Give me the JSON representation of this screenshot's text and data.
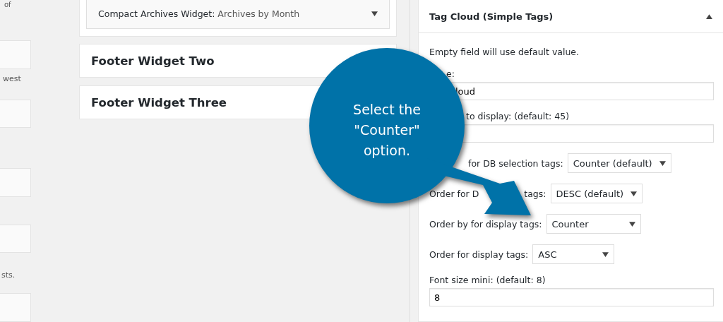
{
  "left_column": {
    "texts": [
      "of",
      "west",
      "sts."
    ]
  },
  "widget_area": {
    "widget": {
      "title": "**Compact Archives Widget:** Archives by Month",
      "expanded": false
    },
    "sidebars": [
      {
        "title": "Footer Widget Two"
      },
      {
        "title": "Footer Widget Three"
      }
    ]
  },
  "tag_cloud_widget": {
    "title": "Tag Cloud (Simple Tags)",
    "expanded": true,
    "note": "Empty field will use default value.",
    "rows": [
      {
        "kind": "field",
        "label": [
          "e:"
        ],
        "value": "loud"
      },
      {
        "kind": "field",
        "label": [
          "to display: (default: 45)"
        ],
        "value": ""
      },
      {
        "kind": "select",
        "label": [
          "for DB selection tags:"
        ],
        "value": "Counter (default)"
      },
      {
        "kind": "select",
        "label": [
          "Order for D",
          "tags:"
        ],
        "value": "DESC (default)"
      },
      {
        "kind": "select",
        "label": [
          "Order by for display tags:"
        ],
        "value": "Counter"
      },
      {
        "kind": "select",
        "label": [
          "Order for display tags:"
        ],
        "value": "ASC"
      },
      {
        "kind": "field",
        "label": [
          "Font size mini: (default: 8)"
        ],
        "value": "8"
      }
    ]
  },
  "callout": {
    "text": "Select the \"Counter\" option."
  }
}
